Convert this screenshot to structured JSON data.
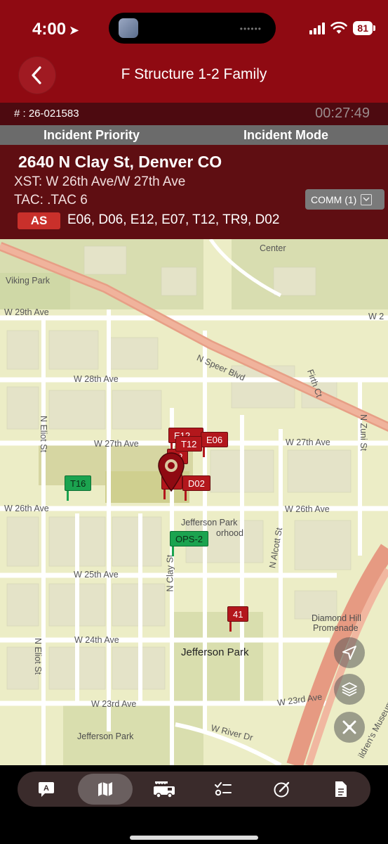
{
  "status": {
    "time": "4:00",
    "battery": "81"
  },
  "header": {
    "title": "F Structure 1-2 Family"
  },
  "incident": {
    "number": "# : 26-021583",
    "timer": "00:27:49",
    "priority_label": "Incident Priority",
    "mode_label": "Incident Mode",
    "address": "2640 N Clay St, Denver CO",
    "xst": "XST: W 26th Ave/W 27th Ave",
    "tac": "TAC: .TAC 6",
    "comm_button": "COMM (1)",
    "assigned_badge": "AS",
    "units": "E06, D06, E12, E07, T12, TR9, D02"
  },
  "map": {
    "labels": {
      "viking_park": "Viking Park",
      "w29": "W 29th Ave",
      "w29_right": "W 2",
      "speer": "N Speer Blvd",
      "firth": "Firth Ct",
      "w28": "W 28th Ave",
      "w27_left": "W 27th Ave",
      "w27_right": "W 27th Ave",
      "zuni": "N Zuni St",
      "eliot_top": "N Eliot St",
      "w26_left": "W 26th Ave",
      "w26_right": "W 26th Ave",
      "jp_neighborhood_1": "Jefferson Park",
      "jp_neighborhood_2": "orhood",
      "w25": "W 25th Ave",
      "clay": "N Clay St",
      "alcott": "N Alcott St",
      "diamond_hill_1": "Diamond Hill",
      "diamond_hill_2": "Promenade",
      "w24": "W 24th Ave",
      "jefferson_park": "Jefferson Park",
      "eliot_bottom": "N Eliot St",
      "w23_left": "W 23rd Ave",
      "w23_right": "W 23rd Ave",
      "jefferson_park_bottom": "Jefferson Park",
      "river": "W River Dr",
      "center": "Center",
      "museum": "ildren's Museum"
    },
    "markers": {
      "e06": "E06",
      "t12": "T12",
      "back1": "E12",
      "back2": "12",
      "e07": "07",
      "d02": "D02",
      "t16": "T16",
      "ops2": "OPS-2",
      "u41": "41"
    },
    "colors": {
      "unit_red": "#b3171c",
      "unit_green": "#1ba34f",
      "incident_pin": "#8f0a12"
    }
  },
  "tabs": [
    {
      "icon": "chat-icon"
    },
    {
      "icon": "map-icon",
      "active": true
    },
    {
      "icon": "fire-truck-icon"
    },
    {
      "icon": "checklist-icon"
    },
    {
      "icon": "edit-circle-icon"
    },
    {
      "icon": "document-icon"
    }
  ]
}
